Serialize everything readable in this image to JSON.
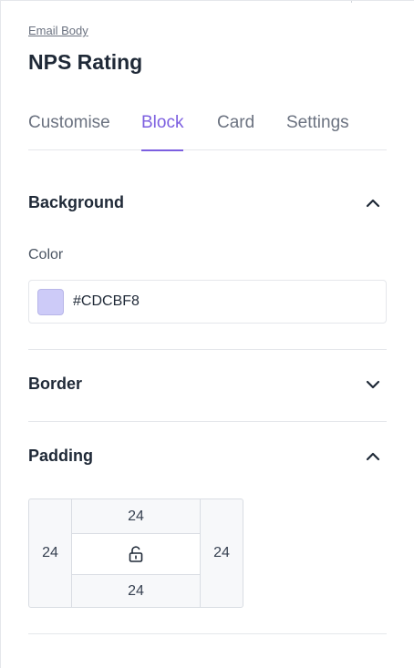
{
  "breadcrumb": "Email Body",
  "title": "NPS Rating",
  "tabs": [
    {
      "label": "Customise",
      "active": false
    },
    {
      "label": "Block",
      "active": true
    },
    {
      "label": "Card",
      "active": false
    },
    {
      "label": "Settings",
      "active": false
    }
  ],
  "sections": {
    "background": {
      "title": "Background",
      "expanded": true,
      "color_label": "Color",
      "color_value": "#CDCBF8",
      "swatch_color": "#CDCBF8"
    },
    "border": {
      "title": "Border",
      "expanded": false
    },
    "padding": {
      "title": "Padding",
      "expanded": true,
      "top": "24",
      "right": "24",
      "bottom": "24",
      "left": "24",
      "lock_icon": "unlock-icon"
    }
  },
  "colors": {
    "accent": "#7c5fe0"
  }
}
